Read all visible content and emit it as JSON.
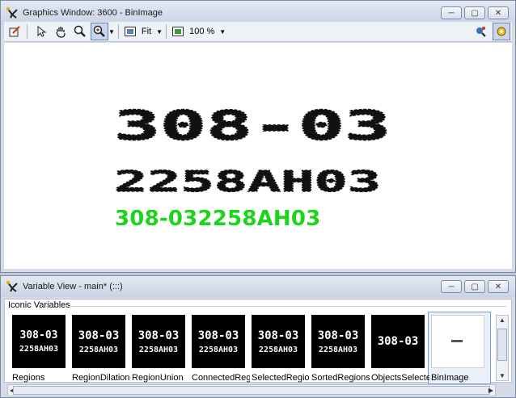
{
  "graphics_window": {
    "title": "Graphics Window: 3600 - BinImage",
    "toolbar": {
      "zoom_mode": "Fit",
      "zoom_percent": "100 %"
    },
    "canvas": {
      "line1": "308-03",
      "line2": "2258AH03",
      "result_text": "308-032258AH03",
      "result_color": "#1cd41c"
    }
  },
  "variable_view": {
    "title": "Variable View - main* (:::)",
    "section_label": "Iconic Variables",
    "items": [
      {
        "label": "Regions",
        "line1": "308-03",
        "line2": "2258AH03"
      },
      {
        "label": "RegionDilation",
        "line1": "308-03",
        "line2": "2258AH03"
      },
      {
        "label": "RegionUnion",
        "line1": "308-03",
        "line2": "2258AH03"
      },
      {
        "label": "ConnectedRegions",
        "line1": "308-03",
        "line2": "2258AH03"
      },
      {
        "label": "SelectedRegions",
        "line1": "308-03",
        "line2": "2258AH03"
      },
      {
        "label": "SortedRegions",
        "line1": "308-03",
        "line2": "2258AH03"
      },
      {
        "label": "ObjectsSelected",
        "line1": "308-03",
        "line2": ""
      },
      {
        "label": "BinImage",
        "line1": "",
        "line2": ""
      }
    ]
  },
  "icons": [
    "halcon-app-icon",
    "minimize-icon",
    "maximize-icon",
    "close-icon",
    "edit-icon",
    "pointer-icon",
    "pan-hand-icon",
    "zoom-icon",
    "magnify-icon",
    "fit-icon",
    "zoom-percent-icon",
    "inspect-icon",
    "settings-icon"
  ]
}
